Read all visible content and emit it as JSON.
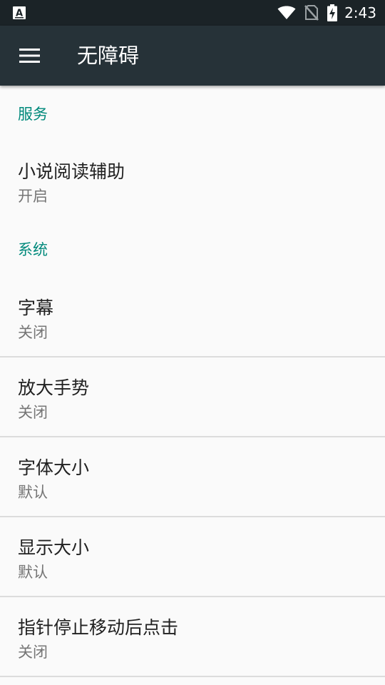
{
  "status_bar": {
    "left_icon": "accessibility-a-icon",
    "icons": [
      "wifi-icon",
      "no-sim-icon",
      "battery-charging-icon"
    ],
    "time": "2:43"
  },
  "app_bar": {
    "menu_icon": "hamburger-menu-icon",
    "title": "无障碍"
  },
  "sections": [
    {
      "header": "服务",
      "items": [
        {
          "title": "小说阅读辅助",
          "summary": "开启"
        }
      ]
    },
    {
      "header": "系统",
      "items": [
        {
          "title": "字幕",
          "summary": "关闭"
        },
        {
          "title": "放大手势",
          "summary": "关闭"
        },
        {
          "title": "字体大小",
          "summary": "默认"
        },
        {
          "title": "显示大小",
          "summary": "默认"
        },
        {
          "title": "指针停止移动后点击",
          "summary": "关闭"
        }
      ]
    }
  ],
  "colors": {
    "status_bar": "#1b2327",
    "app_bar": "#263238",
    "accent": "#00897b",
    "background": "#fafafa",
    "title_text": "#212121",
    "summary_text": "#757575"
  }
}
